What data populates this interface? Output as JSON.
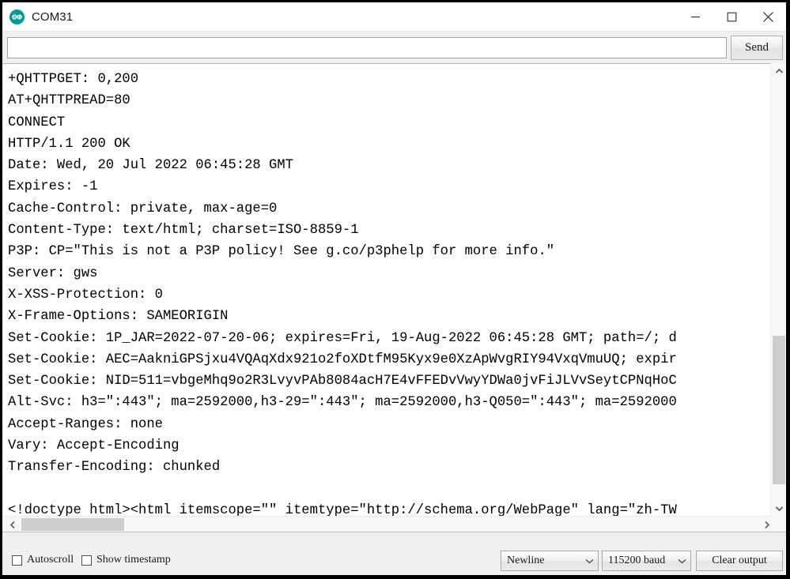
{
  "window": {
    "title": "COM31",
    "icon": "arduino-logo-icon",
    "controls": {
      "minimize": "minimize-icon",
      "maximize": "maximize-icon",
      "close": "close-icon"
    }
  },
  "send_bar": {
    "input_value": "",
    "input_placeholder": "",
    "send_label": "Send"
  },
  "output": {
    "lines": [
      "+QHTTPGET: 0,200",
      "AT+QHTTPREAD=80",
      "CONNECT",
      "HTTP/1.1 200 OK",
      "Date: Wed, 20 Jul 2022 06:45:28 GMT",
      "Expires: -1",
      "Cache-Control: private, max-age=0",
      "Content-Type: text/html; charset=ISO-8859-1",
      "P3P: CP=\"This is not a P3P policy! See g.co/p3phelp for more info.\"",
      "Server: gws",
      "X-XSS-Protection: 0",
      "X-Frame-Options: SAMEORIGIN",
      "Set-Cookie: 1P_JAR=2022-07-20-06; expires=Fri, 19-Aug-2022 06:45:28 GMT; path=/; d",
      "Set-Cookie: AEC=AakniGPSjxu4VQAqXdx921o2foXDtfM95Kyx9e0XzApWvgRIY94VxqVmuUQ; expir",
      "Set-Cookie: NID=511=vbgeMhq9o2R3LvyvPAb8084acH7E4vFFEDvVwyYDWa0jvFiJLVvSeytCPNqHoC",
      "Alt-Svc: h3=\":443\"; ma=2592000,h3-29=\":443\"; ma=2592000,h3-Q050=\":443\"; ma=2592000",
      "Accept-Ranges: none",
      "Vary: Accept-Encoding",
      "Transfer-Encoding: chunked",
      "",
      "<!doctype html><html itemscope=\"\" itemtype=\"http://schema.org/WebPage\" lang=\"zh-TW"
    ]
  },
  "scrollbars": {
    "vertical": {
      "up_icon": "chevron-up-icon",
      "down_icon": "chevron-down-icon"
    },
    "horizontal": {
      "left_icon": "chevron-left-icon",
      "right_icon": "chevron-right-icon"
    }
  },
  "footer": {
    "autoscroll_label": "Autoscroll",
    "autoscroll_checked": false,
    "show_timestamp_label": "Show timestamp",
    "show_timestamp_checked": false,
    "line_ending_selected": "Newline",
    "baud_selected": "115200 baud",
    "clear_output_label": "Clear output"
  },
  "colors": {
    "accent": "#00979c",
    "window_bg": "#ffffff",
    "chrome_bg": "#f0f0f0",
    "scroll_thumb": "#cdcdcd"
  }
}
